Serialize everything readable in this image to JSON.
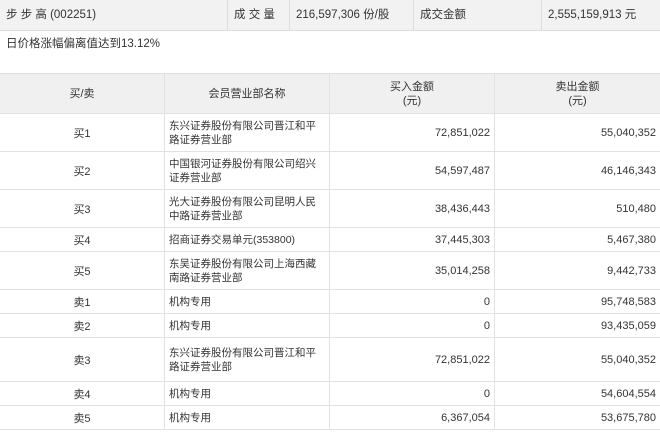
{
  "summary": {
    "stock_name_code": "步 步 高 (002251)",
    "volume_label": "成 交 量",
    "volume_value": "216,597,306 份/股",
    "amount_label": "成交金额",
    "amount_value": "2,555,159,913 元"
  },
  "deviation_note": "日价格涨幅偏离值达到13.12%",
  "table": {
    "headers": {
      "side": "买/卖",
      "member": "会员营业部名称",
      "buy_amount": "买入金额",
      "buy_unit": "(元)",
      "sell_amount": "卖出金额",
      "sell_unit": "(元)"
    },
    "rows": [
      {
        "side": "买1",
        "member": "东兴证券股份有限公司晋江和平路证券营业部",
        "buy": "72,851,022",
        "sell": "55,040,352"
      },
      {
        "side": "买2",
        "member": "中国银河证券股份有限公司绍兴证券营业部",
        "buy": "54,597,487",
        "sell": "46,146,343"
      },
      {
        "side": "买3",
        "member": "光大证券股份有限公司昆明人民中路证券营业部",
        "buy": "38,436,443",
        "sell": "510,480"
      },
      {
        "side": "买4",
        "member": "招商证券交易单元(353800)",
        "buy": "37,445,303",
        "sell": "5,467,380"
      },
      {
        "side": "买5",
        "member": "东吴证券股份有限公司上海西藏南路证券营业部",
        "buy": "35,014,258",
        "sell": "9,442,733"
      },
      {
        "side": "卖1",
        "member": "机构专用",
        "buy": "0",
        "sell": "95,748,583"
      },
      {
        "side": "卖2",
        "member": "机构专用",
        "buy": "0",
        "sell": "93,435,059"
      },
      {
        "side": "卖3",
        "member": "东兴证券股份有限公司晋江和平路证券营业部",
        "buy": "72,851,022",
        "sell": "55,040,352"
      },
      {
        "side": "卖4",
        "member": "机构专用",
        "buy": "0",
        "sell": "54,604,554"
      },
      {
        "side": "卖5",
        "member": "机构专用",
        "buy": "6,367,054",
        "sell": "53,675,780"
      }
    ]
  }
}
